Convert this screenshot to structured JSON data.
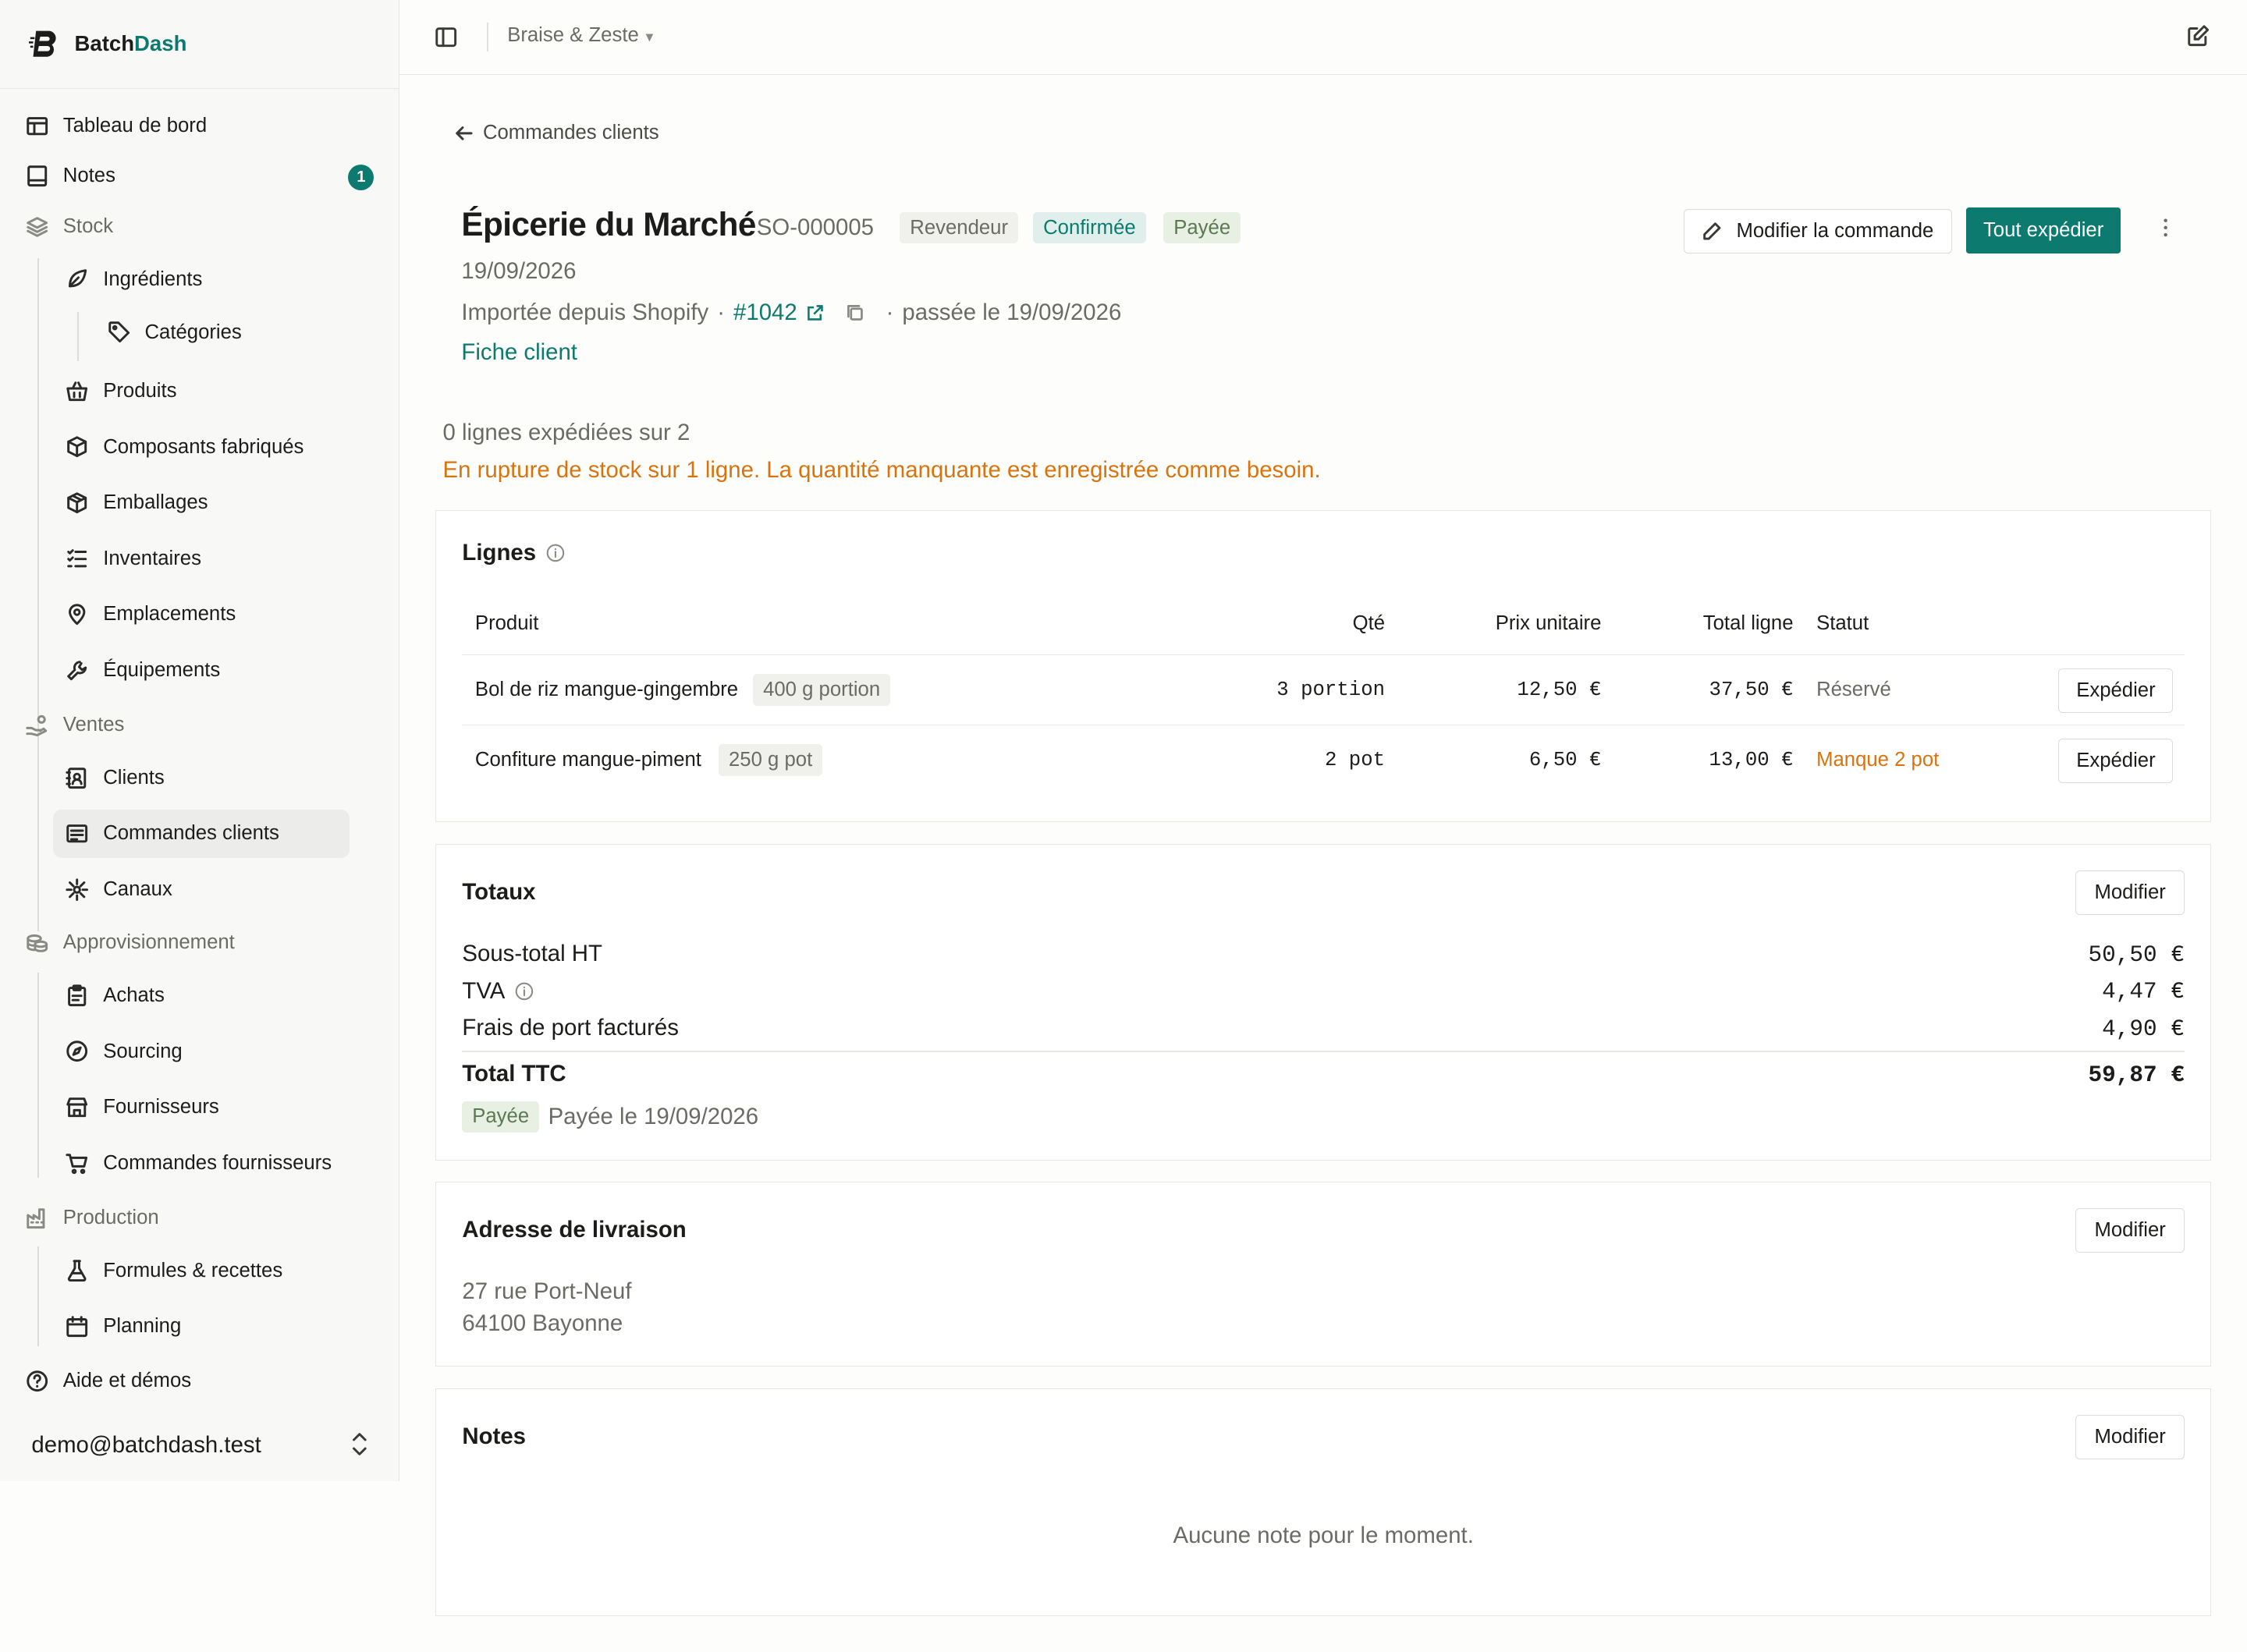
{
  "app": {
    "brand_prefix": "Batch",
    "brand_accent": "Dash"
  },
  "sidebar": {
    "items": [
      {
        "label": "Tableau de bord",
        "icon": "layout-icon"
      },
      {
        "label": "Notes",
        "icon": "notebook-icon",
        "badge": "1"
      },
      {
        "label": "Stock",
        "icon": "layers-icon"
      },
      {
        "label": "Ingrédients",
        "icon": "leaf-icon"
      },
      {
        "label": "Catégories",
        "icon": "tag-icon"
      },
      {
        "label": "Produits",
        "icon": "basket-icon"
      },
      {
        "label": "Composants fabriqués",
        "icon": "box-icon"
      },
      {
        "label": "Emballages",
        "icon": "package-icon"
      },
      {
        "label": "Inventaires",
        "icon": "checklist-icon"
      },
      {
        "label": "Emplacements",
        "icon": "map-pin-icon"
      },
      {
        "label": "Équipements",
        "icon": "wrench-icon"
      },
      {
        "label": "Ventes",
        "icon": "hand-coins-icon"
      },
      {
        "label": "Clients",
        "icon": "contact-icon"
      },
      {
        "label": "Commandes clients",
        "icon": "receipt-icon"
      },
      {
        "label": "Canaux",
        "icon": "network-icon"
      },
      {
        "label": "Approvisionnement",
        "icon": "coins-icon"
      },
      {
        "label": "Achats",
        "icon": "clipboard-icon"
      },
      {
        "label": "Sourcing",
        "icon": "compass-icon"
      },
      {
        "label": "Fournisseurs",
        "icon": "store-icon"
      },
      {
        "label": "Commandes fournisseurs",
        "icon": "cart-icon"
      },
      {
        "label": "Production",
        "icon": "factory-icon"
      },
      {
        "label": "Formules & recettes",
        "icon": "flask-icon"
      },
      {
        "label": "Planning",
        "icon": "calendar-icon"
      },
      {
        "label": "Aide et démos",
        "icon": "help-icon"
      }
    ],
    "user_email": "demo@batchdash.test"
  },
  "topbar": {
    "workspace": "Braise & Zeste"
  },
  "page": {
    "back_label": "Commandes clients",
    "customer": "Épicerie du Marché",
    "order_id": "SO-000005",
    "tags": [
      "Revendeur",
      "Confirmée",
      "Payée"
    ],
    "date": "19/09/2026",
    "imported_from": "Importée depuis Shopify",
    "dot1": "·",
    "external_ref": "#1042",
    "dot2": "·",
    "placed_on": "passée le 19/09/2026",
    "customer_link": "Fiche client",
    "edit_order": "Modifier la commande",
    "ship_all": "Tout expédier",
    "shipped_status": "0 lignes expédiées sur 2",
    "stock_warning": "En rupture de stock sur 1 ligne. La quantité manquante est enregistrée comme besoin."
  },
  "lines": {
    "title": "Lignes",
    "headers": {
      "product": "Produit",
      "qty": "Qté",
      "unit_price": "Prix unitaire",
      "line_total": "Total ligne",
      "status": "Statut"
    },
    "rows": [
      {
        "product": "Bol de riz mangue-gingembre",
        "variant": "400 g portion",
        "qty": "3 portion",
        "unit_price": "12,50 €",
        "line_total": "37,50 €",
        "status": "Réservé",
        "action": "Expédier"
      },
      {
        "product": "Confiture mangue-piment",
        "variant": "250 g pot",
        "qty": "2 pot",
        "unit_price": "6,50 €",
        "line_total": "13,00 €",
        "status": "Manque 2 pot",
        "action": "Expédier"
      }
    ]
  },
  "totals": {
    "title": "Totaux",
    "edit": "Modifier",
    "subtotal_label": "Sous-total HT",
    "subtotal": "50,50 €",
    "vat_label": "TVA",
    "vat": "4,47 €",
    "shipping_label": "Frais de port facturés",
    "shipping": "4,90 €",
    "total_label": "Total TTC",
    "total": "59,87 €",
    "paid_badge": "Payée",
    "paid_on": "Payée le 19/09/2026"
  },
  "shipping_address": {
    "title": "Adresse de livraison",
    "edit": "Modifier",
    "line1": "27 rue Port-Neuf",
    "line2": "64100 Bayonne"
  },
  "notes": {
    "title": "Notes",
    "edit": "Modifier",
    "empty": "Aucune note pour le moment."
  },
  "colors": {
    "accent": "#0c7a6e",
    "warning": "#d9730d"
  }
}
